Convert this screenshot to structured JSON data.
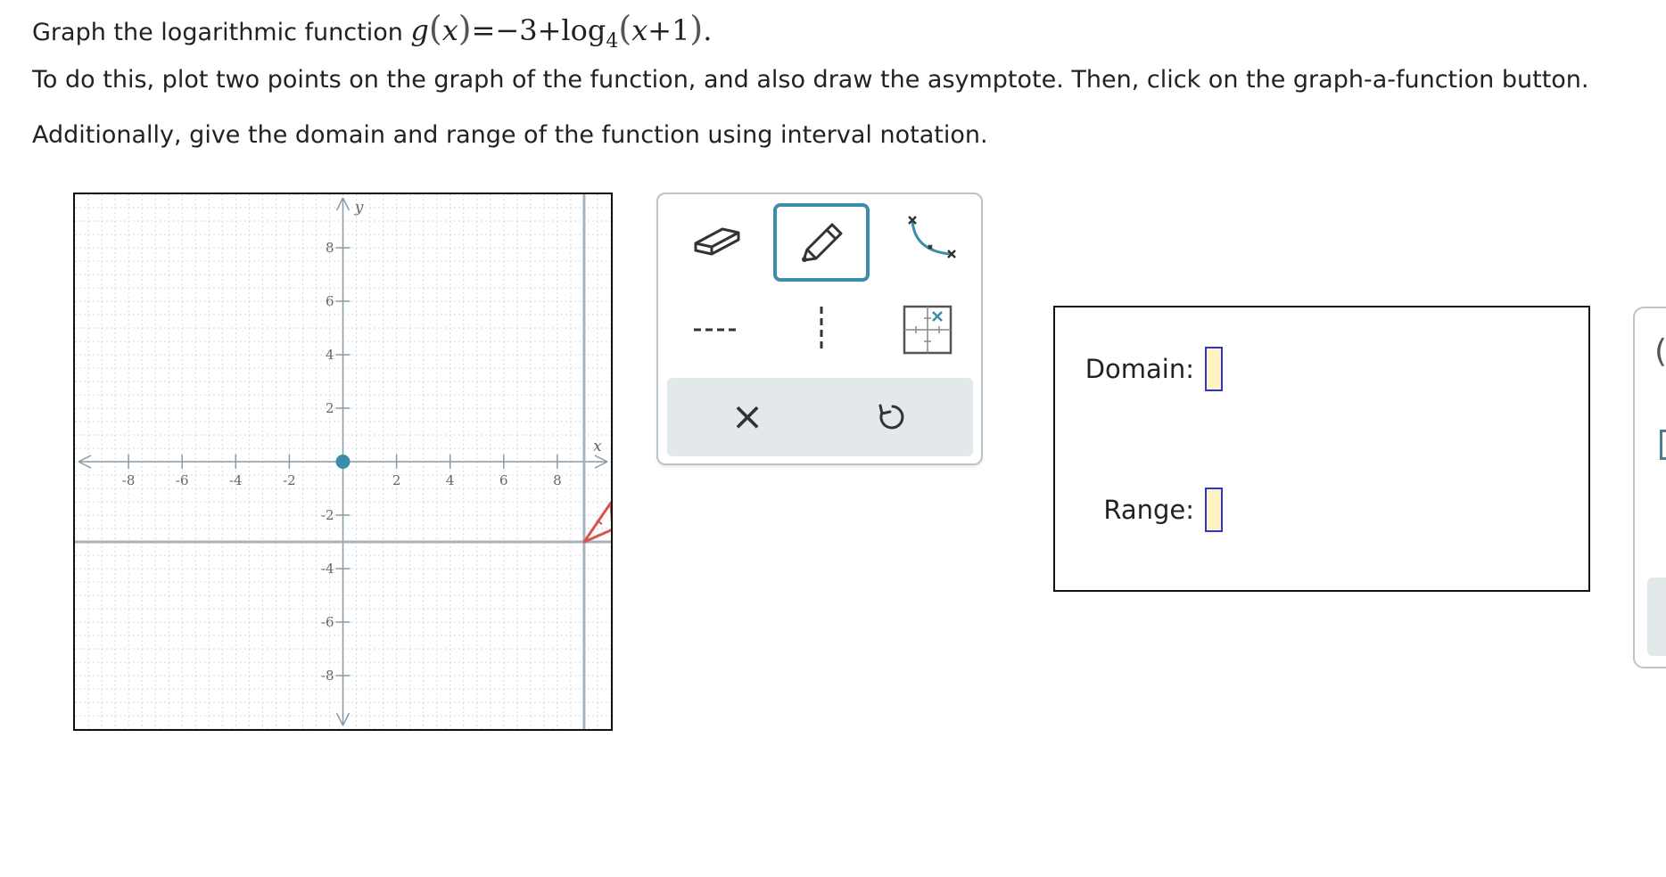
{
  "question": {
    "line1_prefix": "Graph the logarithmic function ",
    "func_name": "g",
    "var": "x",
    "equals": "=",
    "minus3": "−3+",
    "log": "log",
    "base": "4",
    "arg_var": "x",
    "arg_rest": "+1",
    "period": ".",
    "line2": "To do this, plot two points on the graph of the function, and also draw the asymptote. Then, click on the graph-a-function button.",
    "line3": "Additionally, give the domain and range of the function using interval notation."
  },
  "graph": {
    "x_axis_label": "x",
    "y_axis_label": "y",
    "x_range": [
      -10,
      10
    ],
    "y_range": [
      -10,
      10
    ],
    "x_ticks": [
      "-8",
      "-6",
      "-4",
      "-2",
      "2",
      "4",
      "6",
      "8"
    ],
    "y_ticks": [
      "8",
      "6",
      "4",
      "2",
      "-2",
      "-4",
      "-6",
      "-8"
    ],
    "plotted_point": {
      "x": 0,
      "y": 0
    },
    "horizontal_line_y": -3,
    "vertical_line_x": 9,
    "point_color": "#3c8cab",
    "line_color": "#a4b3bd",
    "marker_color": "#d9534f"
  },
  "tools": {
    "eraser": "eraser-icon",
    "pencil": "pencil-icon",
    "curve": "log-curve-icon",
    "dashed_h": "dashed-horizontal-line-icon",
    "dashed_v": "dashed-vertical-line-icon",
    "graph_function": "graph-function-icon",
    "clear": "×",
    "undo": "undo-icon"
  },
  "domain_range": {
    "domain_label": "Domain:",
    "range_label": "Range:"
  },
  "side_panel": {
    "paren": "("
  }
}
